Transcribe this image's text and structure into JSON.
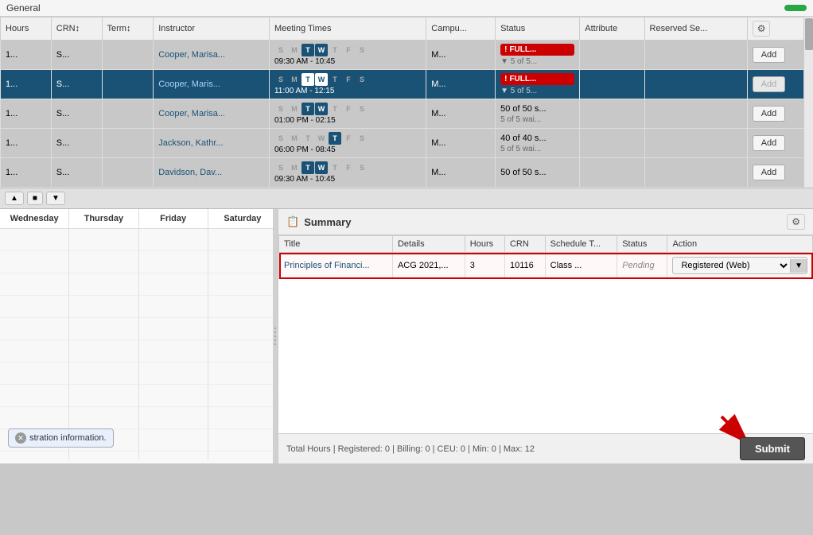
{
  "header": {
    "section_label": "General",
    "green_button_label": ""
  },
  "table": {
    "columns": [
      "hours",
      "CRN",
      "Term",
      "Instructor",
      "Meeting Times",
      "Campus",
      "Status",
      "Attribute",
      "Reserved Seats",
      "action"
    ],
    "col_headers": {
      "hours": "Hours",
      "crn": "CRN ↕",
      "term": "Term ↕",
      "instructor": "Instructor",
      "meeting_times": "Meeting Times",
      "campus": "Campu...",
      "status": "Status",
      "attribute": "Attribute",
      "reserved_seats": "Reserved Se...",
      "action": ""
    },
    "rows": [
      {
        "hours": "1...",
        "crn": "S...",
        "term": "",
        "instructor": "Cooper, Marisa...",
        "days": [
          "S",
          "M",
          "T",
          "W",
          "T",
          "F",
          "S"
        ],
        "active_days": [
          2,
          3
        ],
        "time": "09:30 AM - 10:45",
        "campus": "M...",
        "status_label": "FULL...",
        "status_sub": "5 of 5...",
        "attribute": "",
        "reserved": "",
        "action": "Add",
        "selected": false,
        "full": true
      },
      {
        "hours": "1...",
        "crn": "S...",
        "term": "",
        "instructor": "Cooper, Maris...",
        "days": [
          "S",
          "M",
          "T",
          "W",
          "T",
          "F",
          "S"
        ],
        "active_days": [
          2,
          3
        ],
        "time": "11:00 AM - 12:15",
        "campus": "M...",
        "status_label": "FULL...",
        "status_sub": "5 of 5...",
        "attribute": "",
        "reserved": "",
        "action": "Add",
        "selected": true,
        "full": true
      },
      {
        "hours": "1...",
        "crn": "S...",
        "term": "",
        "instructor": "Cooper, Marisa...",
        "days": [
          "S",
          "M",
          "T",
          "W",
          "T",
          "F",
          "S"
        ],
        "active_days": [
          2,
          3
        ],
        "time": "01:00 PM - 02:15",
        "campus": "M...",
        "status_label": "50 of 50 s...",
        "status_sub": "5 of 5 wai...",
        "attribute": "",
        "reserved": "",
        "action": "Add",
        "selected": false,
        "full": false
      },
      {
        "hours": "1...",
        "crn": "S...",
        "term": "",
        "instructor": "Jackson, Kathr...",
        "days": [
          "S",
          "M",
          "T",
          "W",
          "T",
          "F",
          "S"
        ],
        "active_days": [
          4
        ],
        "time": "06:00 PM - 08:45",
        "campus": "M...",
        "status_label": "40 of 40 s...",
        "status_sub": "5 of 5 wai...",
        "attribute": "",
        "reserved": "",
        "action": "Add",
        "selected": false,
        "full": false
      },
      {
        "hours": "1...",
        "crn": "S...",
        "term": "",
        "instructor": "Davidson, Dav...",
        "days": [
          "S",
          "M",
          "T",
          "W",
          "T",
          "F",
          "S"
        ],
        "active_days": [
          2,
          3
        ],
        "time": "09:30 AM - 10:45",
        "campus": "M...",
        "status_label": "50 of 50 s...",
        "status_sub": "",
        "attribute": "",
        "reserved": "",
        "action": "Add",
        "selected": false,
        "full": false
      }
    ]
  },
  "calendar": {
    "days": [
      "Wednesday",
      "Thursday",
      "Friday",
      "Saturday"
    ]
  },
  "summary": {
    "title": "Summary",
    "col_headers": {
      "title": "Title",
      "details": "Details",
      "hours": "Hours",
      "crn": "CRN",
      "schedule_type": "Schedule T...",
      "status": "Status",
      "action": "Action"
    },
    "rows": [
      {
        "title": "Principles of Financi...",
        "details": "ACG 2021,...",
        "hours": "3",
        "crn": "10116",
        "schedule_type": "Class ...",
        "status": "Pending",
        "action": "Registered (Web)",
        "highlighted": true
      }
    ]
  },
  "footer": {
    "text": "Total Hours | Registered: 0 | Billing: 0 | CEU: 0 | Min: 0 | Max: 12",
    "submit_label": "Submit"
  },
  "tooltip": {
    "text": "stration information."
  }
}
